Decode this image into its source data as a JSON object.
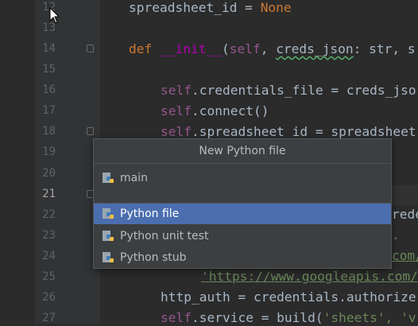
{
  "editor": {
    "line_numbers": [
      "12",
      "13",
      "14",
      "15",
      "16",
      "17",
      "18",
      "19",
      "20",
      "21",
      "22",
      "23",
      "24",
      "25",
      "26",
      "27"
    ],
    "current_line": "21",
    "lines": {
      "l12": {
        "a": "spreadsheet_id = ",
        "b": "None"
      },
      "l14": {
        "kw": "def ",
        "fn": "__init__",
        "p1": "(",
        "self": "self",
        "c1": ", ",
        "creds": "creds_json",
        "rest": ": str, s"
      },
      "l16": {
        "self": "self",
        "rest": ".credentials_file = creds_jso"
      },
      "l17": {
        "self": "self",
        "rest": ".connect()"
      },
      "l18": {
        "self": "self",
        "rest": ".spreadsheet_id = spreadsheet"
      },
      "l22": {
        "rest": "rede"
      },
      "l23": {
        "rest": "."
      },
      "l24": {
        "rest": "com/"
      },
      "l25": {
        "url": "'https://www.googleapis.com/"
      },
      "l26": {
        "rest": "http_auth = credentials.authorize"
      },
      "l27": {
        "self": "self",
        "rest": ".service = build(",
        "s1": "'sheets'",
        "s2": ", 'v"
      }
    }
  },
  "popup": {
    "title": "New Python file",
    "items": [
      {
        "label": "main",
        "icon": "python-file-icon"
      },
      {
        "label": "Python file",
        "icon": "python-file-icon",
        "selected": true
      },
      {
        "label": "Python unit test",
        "icon": "python-file-icon"
      },
      {
        "label": "Python stub",
        "icon": "python-file-icon"
      }
    ]
  },
  "colors": {
    "background": "#2b2b2b",
    "gutter": "#313335",
    "popup_bg": "#3c3f41",
    "selection": "#4b6eaf",
    "keyword": "#cc7832",
    "self": "#94558d"
  }
}
